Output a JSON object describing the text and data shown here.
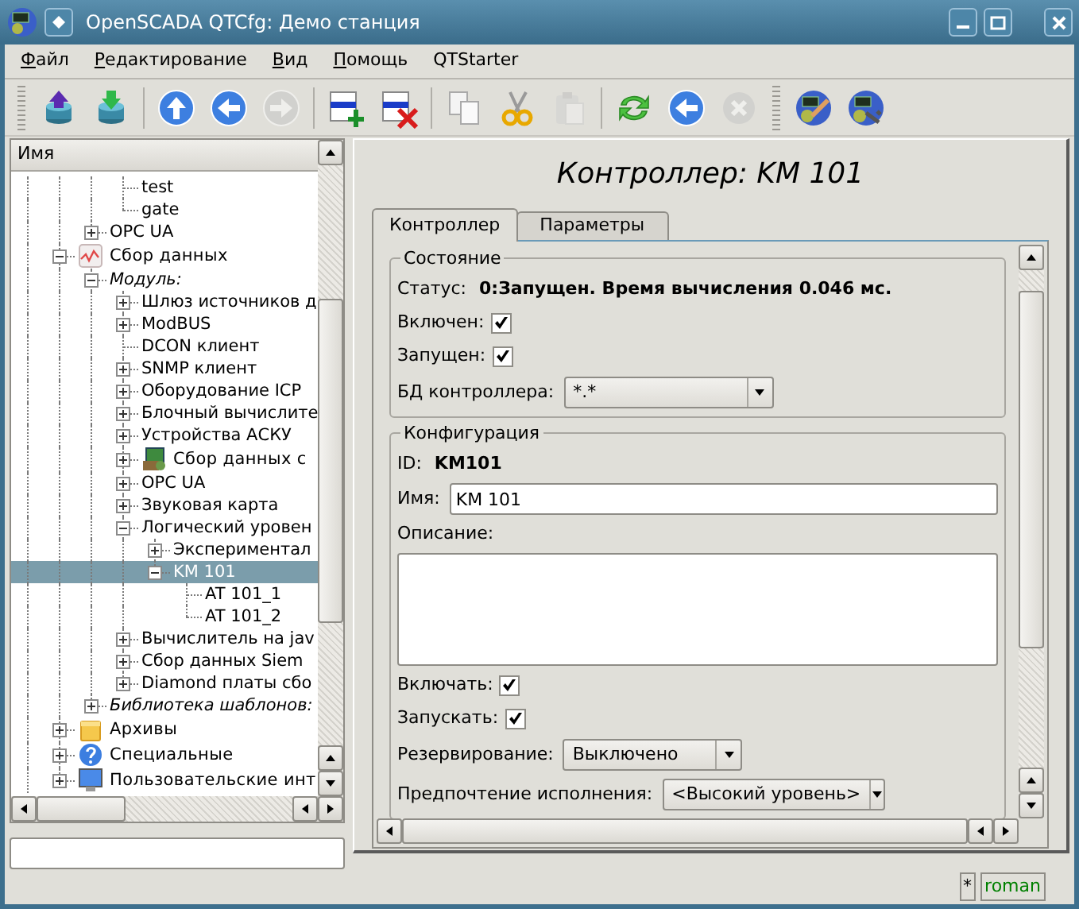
{
  "window": {
    "title": "OpenSCADA QTCfg: Демо станция"
  },
  "menu": [
    {
      "label": "Файл",
      "mnemonic": true
    },
    {
      "label": "Редактирование",
      "mnemonic": true
    },
    {
      "label": "Вид",
      "mnemonic": true
    },
    {
      "label": "Помощь",
      "mnemonic": true
    },
    {
      "label": "QTStarter",
      "mnemonic": false
    }
  ],
  "toolbar": [
    {
      "kind": "handle"
    },
    {
      "kind": "load",
      "disabled": false
    },
    {
      "kind": "save",
      "disabled": false
    },
    {
      "kind": "separator"
    },
    {
      "kind": "up",
      "disabled": false
    },
    {
      "kind": "back",
      "disabled": false
    },
    {
      "kind": "forward",
      "disabled": true
    },
    {
      "kind": "separator"
    },
    {
      "kind": "add",
      "disabled": false
    },
    {
      "kind": "delete",
      "disabled": false
    },
    {
      "kind": "separator"
    },
    {
      "kind": "copy",
      "disabled": false
    },
    {
      "kind": "cut",
      "disabled": false
    },
    {
      "kind": "paste",
      "disabled": true
    },
    {
      "kind": "separator"
    },
    {
      "kind": "refresh",
      "disabled": false
    },
    {
      "kind": "previous",
      "disabled": false
    },
    {
      "kind": "stop",
      "disabled": true
    },
    {
      "kind": "handle"
    },
    {
      "kind": "station-edit",
      "disabled": false
    },
    {
      "kind": "station-settings",
      "disabled": false
    }
  ],
  "tree": {
    "header": "Имя",
    "items": [
      {
        "children": [
          {
            "children": [
              {
                "children": [
                  {
                    "label": "test",
                    "kind": "item",
                    "selected": false
                  },
                  {
                    "label": "gate",
                    "kind": "item",
                    "selected": false
                  }
                ]
              },
              {
                "label": "OPC UA",
                "kind": "item",
                "expanded": false,
                "selected": false
              }
            ]
          },
          {
            "label": "Сбор данных",
            "kind": "subsystem",
            "expanded": true,
            "selected": false,
            "children": [
              {
                "label": "Модуль:",
                "kind": "group",
                "expanded": true,
                "selected": false,
                "children": [
                  {
                    "label": "Шлюз источников д",
                    "kind": "item",
                    "expanded": false,
                    "selected": false
                  },
                  {
                    "label": "ModBUS",
                    "kind": "item",
                    "expanded": false,
                    "selected": false
                  },
                  {
                    "label": "DCON клиент",
                    "kind": "item",
                    "selected": false
                  },
                  {
                    "label": "SNMP клиент",
                    "kind": "item",
                    "expanded": false,
                    "selected": false
                  },
                  {
                    "label": "Оборудование ICP",
                    "kind": "item",
                    "expanded": false,
                    "selected": false
                  },
                  {
                    "label": "Блочный вычислите",
                    "kind": "item",
                    "expanded": false,
                    "selected": false
                  },
                  {
                    "label": "Устройства АСКУ",
                    "kind": "item",
                    "expanded": false,
                    "selected": false
                  },
                  {
                    "label": "Сбор данных с",
                    "kind": "subsystem",
                    "expanded": false,
                    "selected": false
                  },
                  {
                    "label": "OPC UA",
                    "kind": "item",
                    "expanded": false,
                    "selected": false
                  },
                  {
                    "label": "Звуковая карта",
                    "kind": "item",
                    "expanded": false,
                    "selected": false
                  },
                  {
                    "label": "Логический уровен",
                    "kind": "item",
                    "expanded": true,
                    "selected": false,
                    "children": [
                      {
                        "label": "Экспериментал",
                        "kind": "item",
                        "expanded": false,
                        "selected": false
                      },
                      {
                        "label": "KM 101",
                        "kind": "item",
                        "expanded": true,
                        "selected": true,
                        "children": [
                          {
                            "label": "AT 101_1",
                            "kind": "item",
                            "selected": false
                          },
                          {
                            "label": "AT 101_2",
                            "kind": "item",
                            "selected": false
                          }
                        ]
                      }
                    ]
                  },
                  {
                    "label": "Вычислитель на jav",
                    "kind": "item",
                    "expanded": false,
                    "selected": false
                  },
                  {
                    "label": "Сбор данных Siem",
                    "kind": "item",
                    "expanded": false,
                    "selected": false
                  },
                  {
                    "label": "Diamond платы сбо",
                    "kind": "item",
                    "expanded": false,
                    "selected": false
                  }
                ]
              },
              {
                "label": "Библиотека шаблонов:",
                "kind": "group",
                "expanded": false,
                "selected": false
              }
            ]
          },
          {
            "label": "Архивы",
            "kind": "subsystem",
            "expanded": false,
            "selected": false
          },
          {
            "label": "Специальные",
            "kind": "subsystem",
            "expanded": false,
            "selected": false
          },
          {
            "label": "Пользовательские инт",
            "kind": "subsystem",
            "expanded": false,
            "selected": false
          }
        ]
      }
    ]
  },
  "page": {
    "title": "Контроллер: KM 101",
    "tabs": [
      {
        "label": "Контроллер",
        "selected": true
      },
      {
        "label": "Параметры",
        "selected": false
      }
    ],
    "groups": [
      {
        "title": "Состояние",
        "fields": [
          {
            "kind": "status",
            "label": "Статус:",
            "value": "0:Запущен. Время вычисления 0.046 мс."
          },
          {
            "kind": "checkbox",
            "label": "Включен:",
            "checked": true
          },
          {
            "kind": "checkbox",
            "label": "Запущен:",
            "checked": true
          },
          {
            "kind": "select",
            "label": "БД контроллера:",
            "value": "*.*"
          }
        ]
      },
      {
        "title": "Конфигурация",
        "fields": [
          {
            "kind": "status",
            "label": "ID:",
            "value": "KM101"
          },
          {
            "kind": "input",
            "label": "Имя:",
            "value": "KM 101"
          },
          {
            "kind": "textarea",
            "label": "Описание:"
          },
          {
            "kind": "checkbox",
            "label": "Включать:",
            "checked": true
          },
          {
            "kind": "checkbox",
            "label": "Запускать:",
            "checked": true
          },
          {
            "kind": "select",
            "label": "Резервирование:",
            "value": "Выключено"
          },
          {
            "kind": "select",
            "label": "Предпочтение исполнения:",
            "value": "<Высокий уровень>"
          }
        ]
      }
    ]
  },
  "status_bar": {
    "modified": "*",
    "user": "roman"
  }
}
